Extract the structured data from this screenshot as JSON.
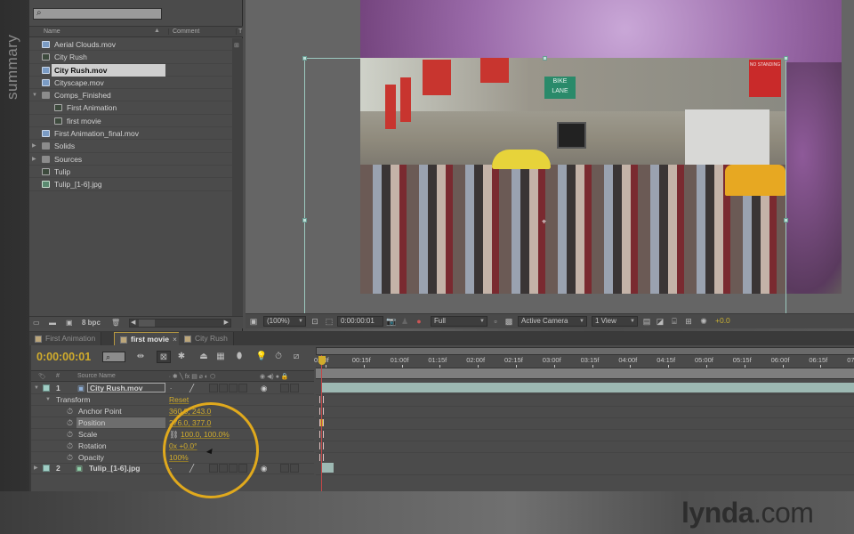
{
  "overlay": {
    "side_label": "summary",
    "watermark_bold": "lynda",
    "watermark_rest": ".com"
  },
  "project": {
    "search_placeholder": "",
    "columns": {
      "name": "Name",
      "comment": "Comment",
      "type": "T"
    },
    "items": [
      {
        "label": "Aerial Clouds.mov",
        "kind": "mov",
        "indent": 0,
        "selected": false
      },
      {
        "label": "City Rush",
        "kind": "comp",
        "indent": 0,
        "selected": false
      },
      {
        "label": "City Rush.mov",
        "kind": "mov",
        "indent": 0,
        "selected": true
      },
      {
        "label": "Cityscape.mov",
        "kind": "mov",
        "indent": 0,
        "selected": false
      },
      {
        "label": "Comps_Finished",
        "kind": "folder",
        "indent": 0,
        "expanded": true,
        "selected": false
      },
      {
        "label": "First Animation",
        "kind": "comp",
        "indent": 1,
        "selected": false
      },
      {
        "label": "first movie",
        "kind": "comp",
        "indent": 1,
        "selected": false
      },
      {
        "label": "First Animation_final.mov",
        "kind": "mov",
        "indent": 0,
        "selected": false
      },
      {
        "label": "Solids",
        "kind": "folder",
        "indent": 0,
        "expanded": false,
        "selected": false
      },
      {
        "label": "Sources",
        "kind": "folder",
        "indent": 0,
        "expanded": false,
        "selected": false
      },
      {
        "label": "Tulip",
        "kind": "comp",
        "indent": 0,
        "selected": false
      },
      {
        "label": "Tulip_[1-6].jpg",
        "kind": "img",
        "indent": 0,
        "selected": false
      }
    ],
    "footer": {
      "bpc": "8 bpc"
    }
  },
  "viewer": {
    "magnification": "(100%)",
    "timecode": "0:00:00:01",
    "resolution": "Full",
    "camera": "Active Camera",
    "views": "1 View",
    "exposure": "+0.0",
    "signs": {
      "bike_lane": "BIKE LANE",
      "no_standing": "NO STANDING"
    }
  },
  "timeline": {
    "tabs": [
      {
        "label": "First Animation",
        "active": false
      },
      {
        "label": "first movie",
        "active": true,
        "close": "×"
      },
      {
        "label": "City Rush",
        "active": false
      }
    ],
    "current_time": "0:00:00:01",
    "layer_header": {
      "num": "#",
      "source_name": "Source Name"
    },
    "ruler_ticks": [
      "0:00f",
      "00:15f",
      "01:00f",
      "01:15f",
      "02:00f",
      "02:15f",
      "03:00f",
      "03:15f",
      "04:00f",
      "04:15f",
      "05:00f",
      "05:15f",
      "06:00f",
      "06:15f",
      "07:0"
    ],
    "layers": [
      {
        "num": "1",
        "name": "City Rush.mov"
      },
      {
        "num": "2",
        "name": "Tulip_[1-6].jpg"
      }
    ],
    "transform": {
      "label": "Transform",
      "reset": "Reset",
      "properties": [
        {
          "name": "Anchor Point",
          "value": "360.0, 243.0"
        },
        {
          "name": "Position",
          "value": "276.0, 377.0"
        },
        {
          "name": "Scale",
          "value": "100.0, 100.0%"
        },
        {
          "name": "Rotation",
          "value": "0x +0.0°"
        },
        {
          "name": "Opacity",
          "value": "100%"
        }
      ]
    }
  },
  "colors": {
    "accent_timecode": "#d1ac2c",
    "highlight_circle": "#e0a91d",
    "layer_bar": "#9db9b3"
  }
}
